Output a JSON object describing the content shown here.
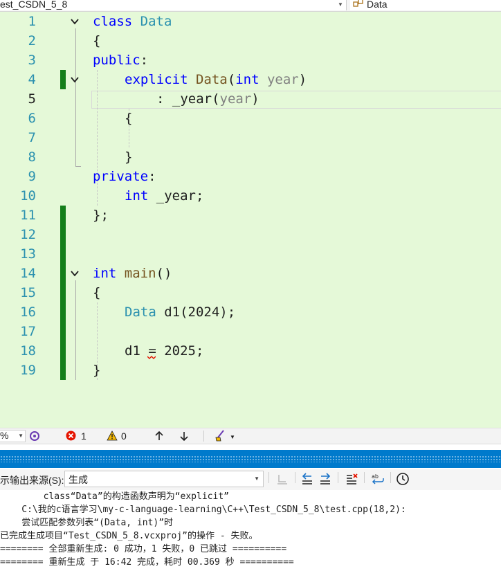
{
  "nav": {
    "file_scope": "est_CSDN_5_8",
    "member_scope": "Data"
  },
  "editor": {
    "current_line": 5,
    "line_numbers": [
      "1",
      "2",
      "3",
      "4",
      "5",
      "6",
      "7",
      "8",
      "9",
      "10",
      "11",
      "12",
      "13",
      "14",
      "15",
      "16",
      "17",
      "18",
      "19"
    ],
    "code": {
      "l1": {
        "kw": "class",
        "ty": "Data"
      },
      "l2": {
        "text": "{"
      },
      "l3": {
        "kw": "public",
        "rest": ":"
      },
      "l4": {
        "kw1": "explicit",
        "fn": "Data",
        "p1": "(",
        "kw2": "int",
        "pm": "year",
        "p2": ")"
      },
      "l5": {
        "a": ": _year(",
        "pm": "year",
        "b": ")"
      },
      "l6": {
        "text": "{"
      },
      "l8": {
        "text": "}"
      },
      "l9": {
        "kw": "private",
        "rest": ":"
      },
      "l10": {
        "kw": "int",
        "rest": " _year;"
      },
      "l11": {
        "text": "};"
      },
      "l14": {
        "kw": "int",
        "fn": "main",
        "rest": "()"
      },
      "l15": {
        "text": "{"
      },
      "l16": {
        "ty": "Data",
        "rest": " d1(2024);"
      },
      "l18": {
        "a": "d1 ",
        "op": "=",
        "b": " 2025;"
      },
      "l19": {
        "text": "}"
      }
    }
  },
  "status_strip": {
    "zoom": "%",
    "errors": "1",
    "warnings": "0"
  },
  "output": {
    "source_label": "示输出来源(S):",
    "source_value": "生成",
    "lines": [
      "        class“Data”的构造函数声明为“explicit”",
      "    C:\\我的c语言学习\\my-c-language-learning\\C++\\Test_CSDN_5_8\\test.cpp(18,2):",
      "    尝试匹配参数列表“(Data, int)”时",
      "已完成生成项目“Test_CSDN_5_8.vcxproj”的操作 - 失败。",
      "======== 全部重新生成: 0 成功，1 失败，0 已跳过 ==========",
      "======== 重新生成 于 16:42 完成，耗时 00.369 秒 =========="
    ]
  },
  "colors": {
    "editor_bg": "#e5f9d8",
    "keyword": "#0000ff",
    "type": "#2b91af",
    "function": "#74531f",
    "param": "#808080",
    "change_bar": "#147e1a",
    "title_bar": "#007acc",
    "error": "#e51400",
    "warning": "#f2b705"
  }
}
